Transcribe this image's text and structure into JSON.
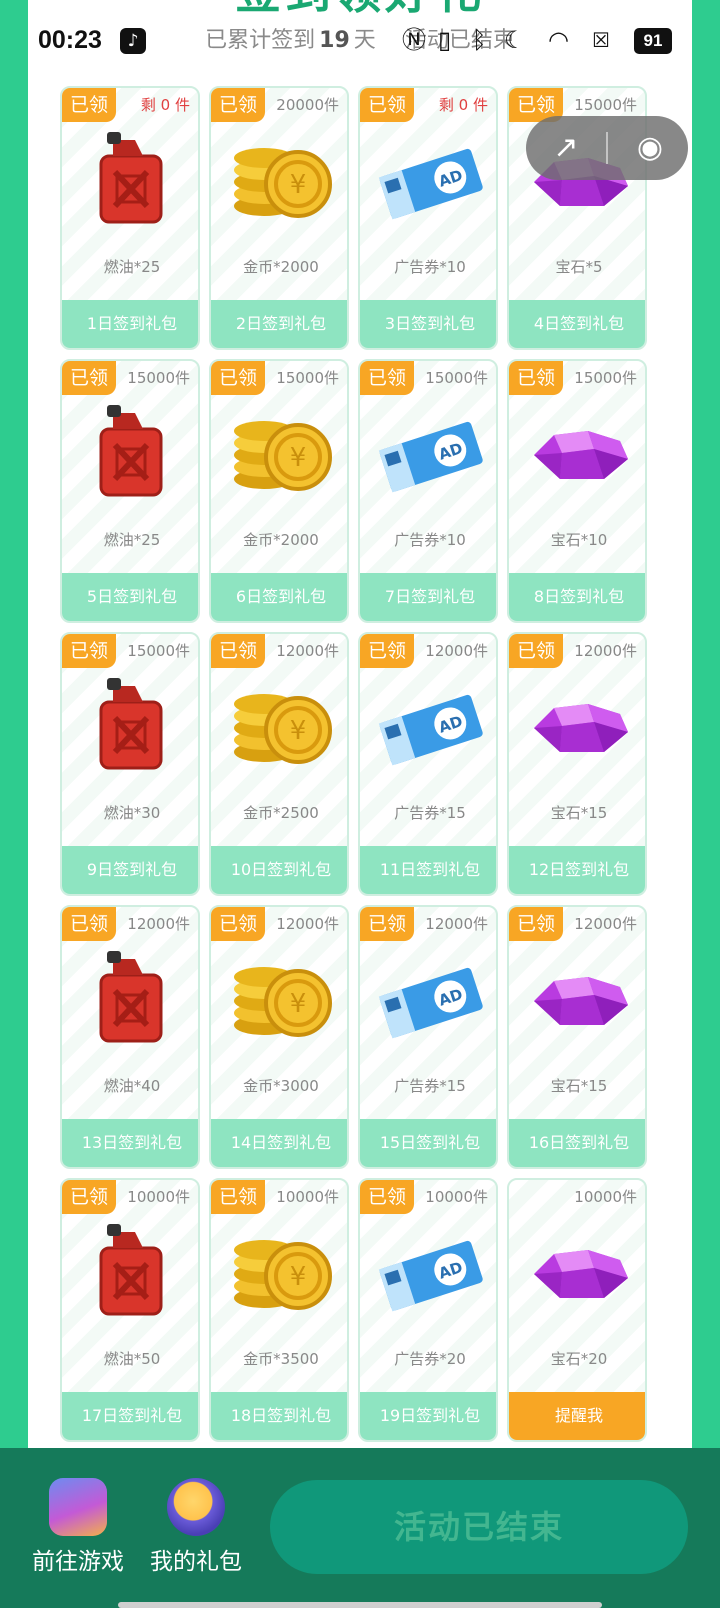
{
  "status_bar": {
    "time": "00:23",
    "battery": "91"
  },
  "header": {
    "title": "签到领好礼",
    "summary_prefix": "已累计签到",
    "summary_days": "19",
    "summary_suffix": "天",
    "status": "活动已结束"
  },
  "badge_label": "已领",
  "cards": [
    {
      "stock": "剩 0 件",
      "stock_red": true,
      "item": "燃油*25",
      "type": "fuel",
      "label": "1日签到礼包",
      "claimed": true
    },
    {
      "stock": "20000件",
      "item": "金币*2000",
      "type": "coin",
      "label": "2日签到礼包",
      "claimed": true
    },
    {
      "stock": "剩 0 件",
      "stock_red": true,
      "item": "广告券*10",
      "type": "ad",
      "label": "3日签到礼包",
      "claimed": true
    },
    {
      "stock": "15000件",
      "item": "宝石*5",
      "type": "gem",
      "label": "4日签到礼包",
      "claimed": true
    },
    {
      "stock": "15000件",
      "item": "燃油*25",
      "type": "fuel",
      "label": "5日签到礼包",
      "claimed": true
    },
    {
      "stock": "15000件",
      "item": "金币*2000",
      "type": "coin",
      "label": "6日签到礼包",
      "claimed": true
    },
    {
      "stock": "15000件",
      "item": "广告券*10",
      "type": "ad",
      "label": "7日签到礼包",
      "claimed": true
    },
    {
      "stock": "15000件",
      "item": "宝石*10",
      "type": "gem",
      "label": "8日签到礼包",
      "claimed": true
    },
    {
      "stock": "15000件",
      "item": "燃油*30",
      "type": "fuel",
      "label": "9日签到礼包",
      "claimed": true
    },
    {
      "stock": "12000件",
      "item": "金币*2500",
      "type": "coin",
      "label": "10日签到礼包",
      "claimed": true
    },
    {
      "stock": "12000件",
      "item": "广告券*15",
      "type": "ad",
      "label": "11日签到礼包",
      "claimed": true
    },
    {
      "stock": "12000件",
      "item": "宝石*15",
      "type": "gem",
      "label": "12日签到礼包",
      "claimed": true
    },
    {
      "stock": "12000件",
      "item": "燃油*40",
      "type": "fuel",
      "label": "13日签到礼包",
      "claimed": true
    },
    {
      "stock": "12000件",
      "item": "金币*3000",
      "type": "coin",
      "label": "14日签到礼包",
      "claimed": true
    },
    {
      "stock": "12000件",
      "item": "广告券*15",
      "type": "ad",
      "label": "15日签到礼包",
      "claimed": true
    },
    {
      "stock": "12000件",
      "item": "宝石*15",
      "type": "gem",
      "label": "16日签到礼包",
      "claimed": true
    },
    {
      "stock": "10000件",
      "item": "燃油*50",
      "type": "fuel",
      "label": "17日签到礼包",
      "claimed": true
    },
    {
      "stock": "10000件",
      "item": "金币*3500",
      "type": "coin",
      "label": "18日签到礼包",
      "claimed": true
    },
    {
      "stock": "10000件",
      "item": "广告券*20",
      "type": "ad",
      "label": "19日签到礼包",
      "claimed": true
    },
    {
      "stock": "10000件",
      "item": "宝石*20",
      "type": "gem",
      "label": "提醒我",
      "claimed": false,
      "footer_orange": true
    }
  ],
  "bottom_bar": {
    "go_game": "前往游戏",
    "my_gifts": "我的礼包",
    "end_button": "活动已结束"
  },
  "colors": {
    "brand_green": "#2ecc8f",
    "dark_green": "#157a5a",
    "badge_orange": "#f8a624",
    "card_footer": "#8ee4c1"
  },
  "icons": {
    "fuel": "fuel-can-icon",
    "coin": "gold-coins-icon",
    "ad": "ad-ticket-icon",
    "gem": "purple-gem-icon"
  }
}
